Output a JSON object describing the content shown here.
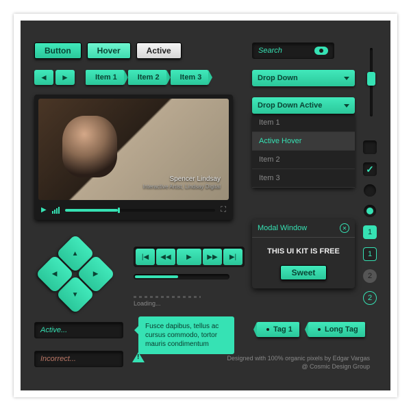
{
  "buttons": {
    "normal": "Button",
    "hover": "Hover",
    "active": "Active"
  },
  "breadcrumb": [
    "Item 1",
    "Item 2",
    "Item 3"
  ],
  "search": {
    "placeholder": "Search"
  },
  "dropdown": {
    "closed": "Drop Down",
    "open": "Drop Down Active",
    "items": [
      "Item 1",
      "Active Hover",
      "Item 2",
      "Item 3"
    ]
  },
  "video": {
    "title": "Spencer Lindsay",
    "subtitle": "Interactive Artist, Lindsay Digital"
  },
  "loading": {
    "label": "Loading..."
  },
  "modal": {
    "title": "Modal Window",
    "body": "THIS UI KIT IS FREE",
    "cta": "Sweet"
  },
  "inputs": {
    "active": "Active...",
    "incorrect": "Incorrect..."
  },
  "tooltip": "Fusce dapibus, tellus ac cursus commodo, tortor mauris condimentum",
  "tags": [
    "Tag 1",
    "Long Tag"
  ],
  "pagination": {
    "sq": [
      "1",
      "1"
    ],
    "circ": [
      "2",
      "2"
    ]
  },
  "credit": {
    "line1": "Designed with 100% organic pixels by Edgar Vargas",
    "line2": "@ Cosmic Design Group"
  }
}
